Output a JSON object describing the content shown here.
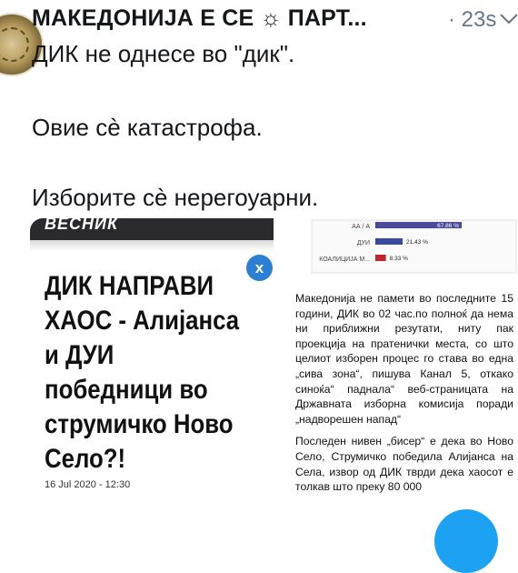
{
  "tweet": {
    "author_name": "МАКЕДОНИЈА Е СЕ ☼ ПАРТ...",
    "time": "· 23s",
    "lines": [
      "ДИК не однесе во \"дик\".",
      "Овие сè катастрофа.",
      "Изборите сè нерегоуарни."
    ]
  },
  "left_image": {
    "masthead": "ВЕСНИК",
    "close_label": "x",
    "headline_lines": [
      "ДИК НАПРАВИ",
      "ХАОС - Алијанса",
      "и ДУИ",
      "победници во",
      "струмичко Ново",
      "Село?!"
    ],
    "date": "16 Jul 2020 - 12:30"
  },
  "right_image": {
    "chart_data": {
      "type": "bar",
      "categories": [
        "АА / А",
        "ДУИ",
        "КОАЛИЦИЈА М..."
      ],
      "values": [
        67.86,
        21.43,
        8.33
      ],
      "value_labels": [
        "67.86 %",
        "21.43 %",
        "8.33 %"
      ],
      "colors": [
        "#4a4a9c",
        "#3b4aa0",
        "#c0272d"
      ],
      "xlim": [
        0,
        100
      ],
      "title": "",
      "xlabel": "",
      "ylabel": ""
    },
    "article_paragraphs": [
      "Македонија не памети во последните 15 години, ДИК во 02 час.по полноќ да нема ни приближни резутати, ниту пак проекција на пратенички места, со што целиот изборен процес го става во една „сива зона“, пишува Канал 5, откако синоќа“ паднала“ веб-страницата на Државната изборна комисија поради „надворешен напад“",
      "Последен нивен „бисер“ е дека во Ново Село, Струмичко победила Алијанса на Села, извор од ДИК тврди дека хаосот е толкав што преку 80 000"
    ]
  },
  "colors": {
    "accent": "#1da1f2",
    "close_button": "#2d7fd3",
    "muted": "#657786"
  }
}
